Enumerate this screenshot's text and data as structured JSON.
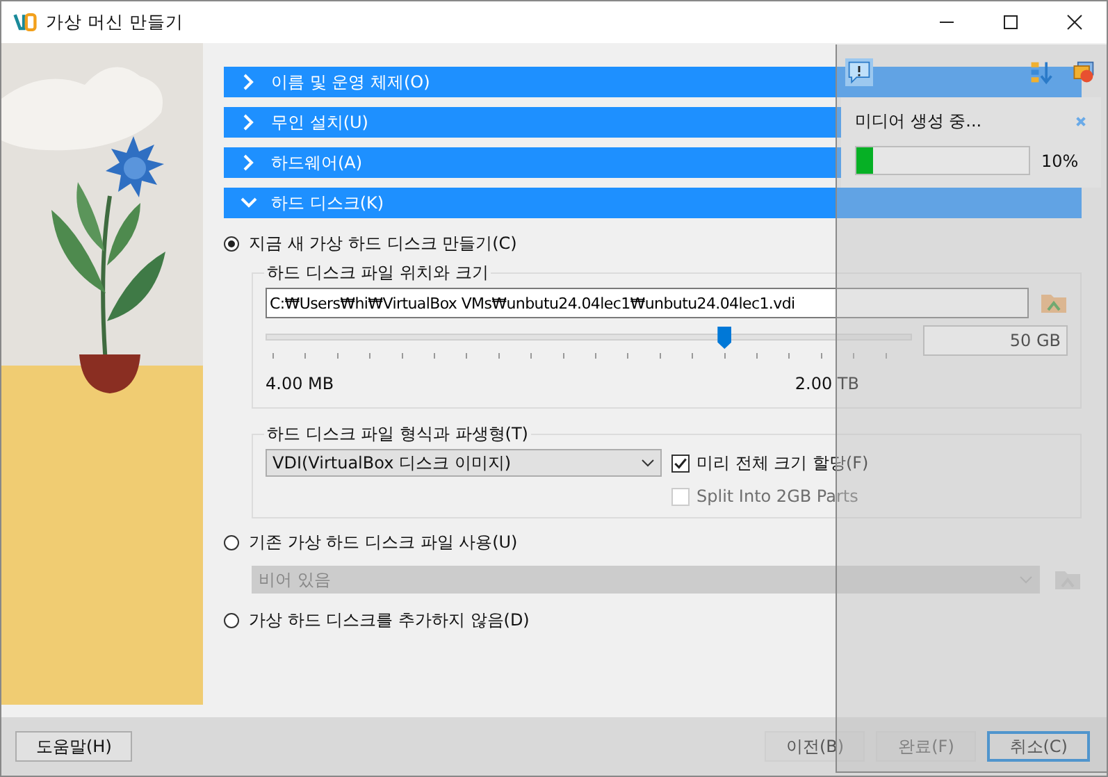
{
  "window": {
    "title": "가상 머신 만들기"
  },
  "sections": [
    {
      "label": "이름 및 운영 체제(O)",
      "expanded": false
    },
    {
      "label": "무인 설치(U)",
      "expanded": false
    },
    {
      "label": "하드웨어(A)",
      "expanded": false
    },
    {
      "label": "하드 디스크(K)",
      "expanded": true
    }
  ],
  "disk_options": [
    {
      "kind": "create",
      "label": "지금 새 가상 하드 디스크 만들기(C)",
      "selected": true
    },
    {
      "kind": "existing",
      "label": "기존 가상 하드 디스크 파일 사용(U)",
      "selected": false
    },
    {
      "kind": "none",
      "label": "가상 하드 디스크를 추가하지 않음(D)",
      "selected": false
    }
  ],
  "location_group": {
    "title": "하드 디스크 파일 위치와 크기",
    "path": "C:₩Users₩hi₩VirtualBox VMs₩unbutu24.04lec1₩unbutu24.04lec1.vdi",
    "size_slider": {
      "level": 0.71,
      "min_label": "4.00 MB",
      "max_label": "2.00 TB"
    },
    "size_value": "50 GB"
  },
  "format_group": {
    "title": "하드 디스크 파일 형식과 파생형(T)",
    "format": "VDI(VirtualBox 디스크 이미지)",
    "options": [
      {
        "label": "미리 전체 크기 할당(F)",
        "checked": true,
        "disabled": false
      },
      {
        "label": "Split Into 2GB Parts",
        "checked": false,
        "disabled": true
      }
    ]
  },
  "existing_file": {
    "value": "비어 있음",
    "disabled": true
  },
  "progress_popup": {
    "title": "미디어 생성 중...",
    "level": 0.1,
    "percent": "10%"
  },
  "buttons": [
    {
      "label": "도움말(H)",
      "disabled": false,
      "focused": false
    },
    {
      "label": "이전(B)",
      "disabled": true,
      "focused": false
    },
    {
      "label": "완료(F)",
      "disabled": true,
      "focused": false
    },
    {
      "label": "취소(C)",
      "disabled": false,
      "focused": true
    }
  ]
}
